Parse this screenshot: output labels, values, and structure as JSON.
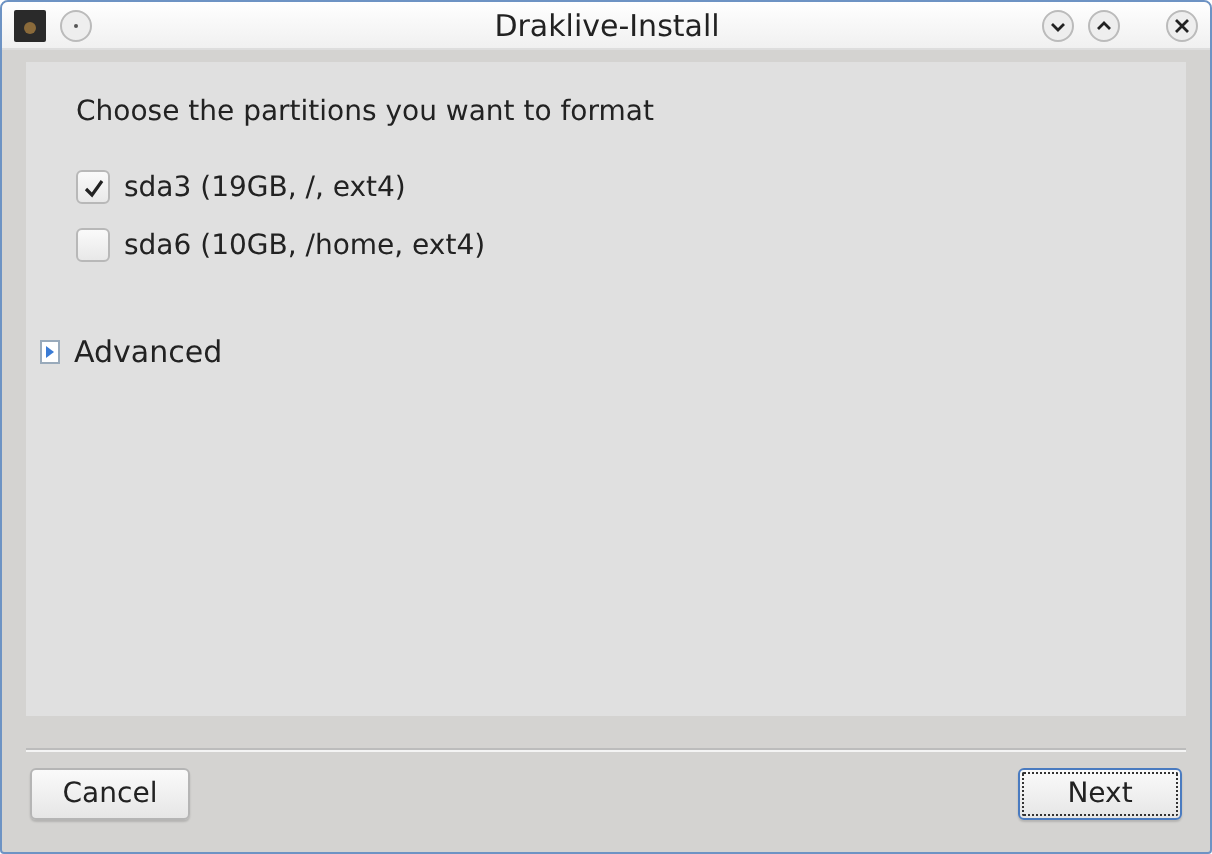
{
  "window": {
    "title": "Draklive-Install"
  },
  "heading": "Choose the partitions you want to format",
  "partitions": [
    {
      "label": "sda3 (19GB, /, ext4)",
      "checked": true
    },
    {
      "label": "sda6 (10GB, /home, ext4)",
      "checked": false
    }
  ],
  "advanced": {
    "label": "Advanced",
    "expanded": false
  },
  "buttons": [
    {
      "label": "Cancel",
      "focused": false
    },
    {
      "label": "Next",
      "focused": true
    }
  ]
}
